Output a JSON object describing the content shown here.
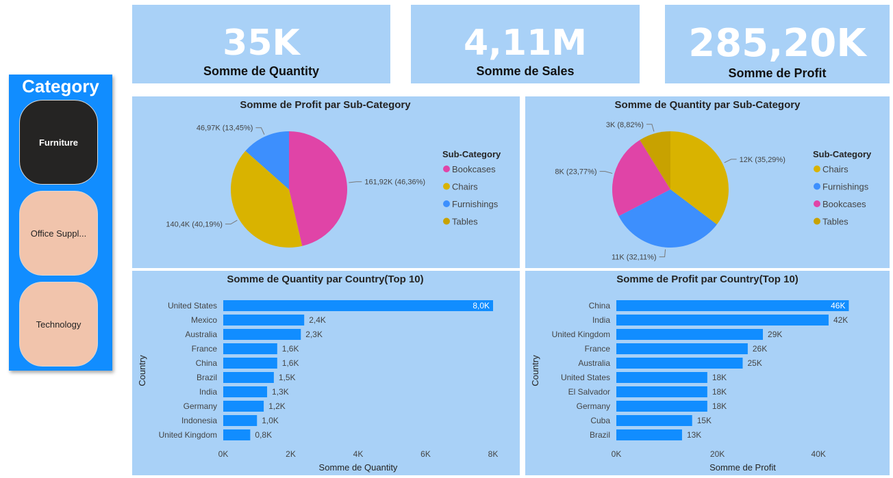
{
  "kpis": [
    {
      "value": "35K",
      "label": "Somme de Quantity"
    },
    {
      "value": "4,11M",
      "label": "Somme de Sales"
    },
    {
      "value": "285,20K",
      "label": "Somme de Profit"
    }
  ],
  "slicer": {
    "title": "Category",
    "items": [
      {
        "label": "Furniture",
        "selected": true
      },
      {
        "label": "Office Suppl...",
        "selected": false
      },
      {
        "label": "Technology",
        "selected": false
      }
    ]
  },
  "colors": {
    "panel_bg": "#a9d1f7",
    "bar": "#118dff",
    "Bookcases": "#e044a7",
    "Chairs": "#d9b300",
    "Furnishings": "#3d8ffd",
    "Tables": "#c8a200"
  },
  "chart_data": [
    {
      "type": "pie",
      "title": "Somme de Profit par Sub-Category",
      "legend_title": "Sub-Category",
      "legend_position": "right",
      "legend": [
        "Bookcases",
        "Chairs",
        "Furnishings",
        "Tables"
      ],
      "slices": [
        {
          "name": "Bookcases",
          "value": 161.92,
          "label": "161,92K (46,36%)"
        },
        {
          "name": "Chairs",
          "value": 140.4,
          "label": "140,4K (40,19%)"
        },
        {
          "name": "Furnishings",
          "value": 46.97,
          "label": "46,97K (13,45%)"
        }
      ]
    },
    {
      "type": "pie",
      "title": "Somme de Quantity par Sub-Category",
      "legend_title": "Sub-Category",
      "legend_position": "right",
      "legend": [
        "Chairs",
        "Furnishings",
        "Bookcases",
        "Tables"
      ],
      "slices": [
        {
          "name": "Chairs",
          "value": 35.29,
          "label": "12K (35,29%)"
        },
        {
          "name": "Furnishings",
          "value": 32.11,
          "label": "11K (32,11%)"
        },
        {
          "name": "Bookcases",
          "value": 23.77,
          "label": "8K (23,77%)"
        },
        {
          "name": "Tables",
          "value": 8.82,
          "label": "3K (8,82%)"
        }
      ]
    },
    {
      "type": "bar",
      "orientation": "horizontal",
      "title": "Somme de Quantity par Country(Top 10)",
      "xlabel": "Somme de Quantity",
      "ylabel": "Country",
      "xlim": [
        0,
        8
      ],
      "xticks": [
        "0K",
        "2K",
        "4K",
        "6K",
        "8K"
      ],
      "categories": [
        "United States",
        "Mexico",
        "Australia",
        "France",
        "China",
        "Brazil",
        "India",
        "Germany",
        "Indonesia",
        "United Kingdom"
      ],
      "values": [
        8.0,
        2.4,
        2.3,
        1.6,
        1.6,
        1.5,
        1.3,
        1.2,
        1.0,
        0.8
      ],
      "labels": [
        "8,0K",
        "2,4K",
        "2,3K",
        "1,6K",
        "1,6K",
        "1,5K",
        "1,3K",
        "1,2K",
        "1,0K",
        "0,8K"
      ]
    },
    {
      "type": "bar",
      "orientation": "horizontal",
      "title": "Somme de Profit par Country(Top 10)",
      "xlabel": "Somme de Profit",
      "ylabel": "Country",
      "xlim": [
        0,
        50
      ],
      "xticks": [
        "0K",
        "20K",
        "40K"
      ],
      "xtick_values": [
        0,
        20,
        40
      ],
      "categories": [
        "China",
        "India",
        "United Kingdom",
        "France",
        "Australia",
        "United States",
        "El Salvador",
        "Germany",
        "Cuba",
        "Brazil"
      ],
      "values": [
        46,
        42,
        29,
        26,
        25,
        18,
        18,
        18,
        15,
        13
      ],
      "labels": [
        "46K",
        "42K",
        "29K",
        "26K",
        "25K",
        "18K",
        "18K",
        "18K",
        "15K",
        "13K"
      ]
    }
  ]
}
